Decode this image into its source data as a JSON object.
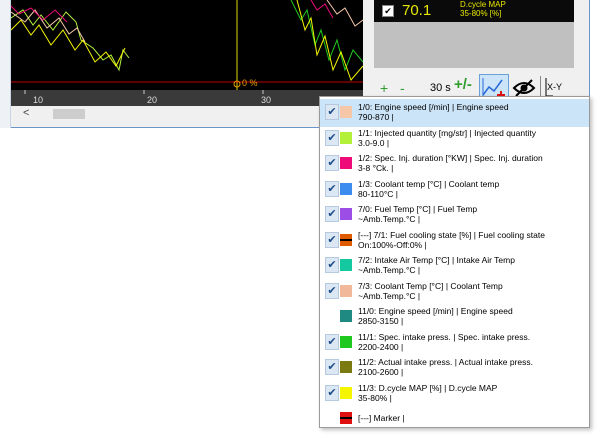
{
  "chart": {
    "x_ticks": [
      "10",
      "20",
      "30"
    ],
    "cursor_label": "0 %"
  },
  "scroll": {
    "left_arrow": "<"
  },
  "value_display": {
    "checked": true,
    "value": "70.1",
    "label_line1": "D.cycle MAP",
    "label_line2": "35-80% [%]",
    "color": "#e8e800"
  },
  "toolbar": {
    "zoom_in": "+",
    "zoom_out": "-",
    "time_window": "30 s",
    "plus_minus": "+/-",
    "xy_label": "X-Y"
  },
  "series": [
    {
      "checked": true,
      "color": "#f5c7a8",
      "line1": "1/0: Engine speed [/min] | Engine speed",
      "line2": "790-870 |"
    },
    {
      "checked": true,
      "color": "#b2f03a",
      "line1": "1/1: Injected quantity [mg/str] | Injected quantity",
      "line2": "3.0-9.0 |"
    },
    {
      "checked": true,
      "color": "#ee0a79",
      "line1": "1/2: Spec. Inj. duration [°KW] | Spec. Inj. duration",
      "line2": "3-8 °Ck. |"
    },
    {
      "checked": true,
      "color": "#3c8cf0",
      "line1": "1/3: Coolant temp [°C] | Coolant temp",
      "line2": "80-110°C |"
    },
    {
      "checked": true,
      "color": "#9b4de6",
      "line1": "7/0: Fuel Temp [°C] | Fuel Temp",
      "line2": "~Amb.Temp.°C |"
    },
    {
      "checked": true,
      "color": "#e05a00",
      "marker": true,
      "line1": "[---] 7/1: Fuel cooling state [%] | Fuel cooling state",
      "line2": "On:100%-Off:0% |"
    },
    {
      "checked": true,
      "color": "#14c8a0",
      "line1": "7/2: Intake Air Temp [°C] | Intake Air Temp",
      "line2": "~Amb.Temp.°C |"
    },
    {
      "checked": true,
      "color": "#f2b89a",
      "line1": "7/3: Coolant Temp [°C] | Coolant Temp",
      "line2": "~Amb.Temp.°C |"
    },
    {
      "checked": false,
      "color": "#1e8a82",
      "line1": "11/0: Engine speed [/min] | Engine speed",
      "line2": "2850-3150 |"
    },
    {
      "checked": true,
      "color": "#1ec81e",
      "line1": "11/1: Spec. intake press. | Spec. intake press.",
      "line2": "2200-2400 |"
    },
    {
      "checked": true,
      "color": "#7a7a10",
      "line1": "11/2: Actual intake press. | Actual intake press.",
      "line2": "2100-2600 |"
    },
    {
      "checked": true,
      "color": "#f5f500",
      "line1": "11/3: D.cycle MAP [%] | D.cycle MAP",
      "line2": "35-80% |"
    },
    {
      "checked": false,
      "color": "#e01010",
      "marker": true,
      "line1": "[---] Marker |",
      "line2": ""
    }
  ]
}
